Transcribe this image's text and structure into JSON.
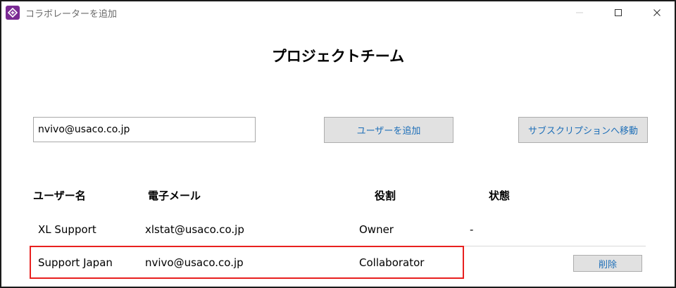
{
  "window": {
    "title": "コラボレーターを追加"
  },
  "page": {
    "title": "プロジェクトチーム"
  },
  "form": {
    "email_value": "nvivo@usaco.co.jp",
    "add_user_label": "ユーザーを追加",
    "subscription_label": "サブスクリプションへ移動"
  },
  "table": {
    "headers": {
      "user": "ユーザー名",
      "email": "電子メール",
      "role": "役割",
      "status": "状態"
    },
    "rows": [
      {
        "user": "XL Support",
        "email": "xlstat@usaco.co.jp",
        "role": "Owner",
        "status": "-"
      },
      {
        "user": "Support Japan",
        "email": "nvivo@usaco.co.jp",
        "role": "Collaborator",
        "status": "",
        "delete_label": "削除"
      }
    ]
  },
  "colors": {
    "accent": "#1e6fb8",
    "highlight": "#e8201f",
    "app_icon": "#7a2a93"
  }
}
